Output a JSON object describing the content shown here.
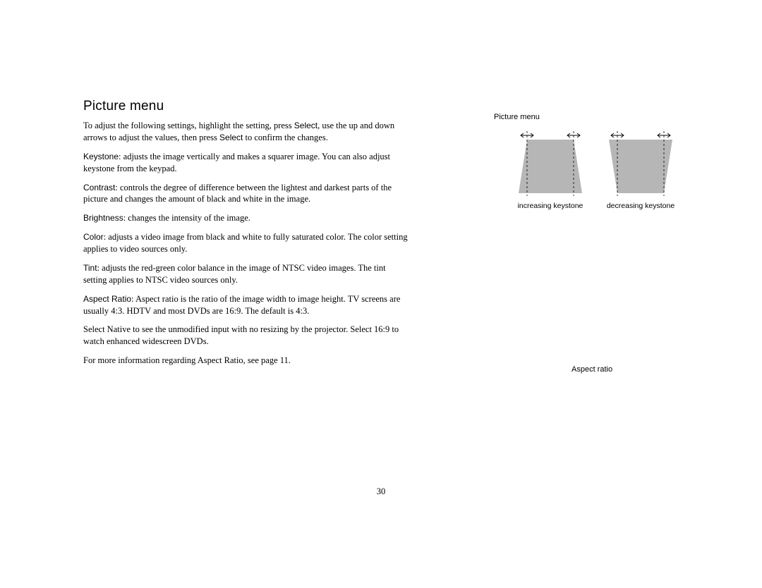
{
  "heading": "Picture menu",
  "intro": {
    "prefix": "To adjust the following settings, highlight the setting, press ",
    "select1": "Select",
    "middle1": ", use the up and down arrows to adjust the values, then press ",
    "select2": "Select",
    "suffix": " to confirm the changes."
  },
  "items": {
    "keystone": {
      "label": "Keystone",
      "text": ": adjusts the image vertically and makes a squarer image. You can also adjust keystone from the keypad."
    },
    "contrast": {
      "label": "Contrast",
      "text": ": controls the degree of difference between the lightest and darkest parts of the picture and changes the amount of black and white in the image."
    },
    "brightness": {
      "label": "Brightness",
      "text": ": changes the intensity of the image."
    },
    "color": {
      "label": "Color",
      "text": ": adjusts a video image from black and white to fully saturated color. The color setting applies to video sources only."
    },
    "tint": {
      "label": "Tint",
      "text": ": adjusts the red-green color balance in the image of NTSC video images. The tint setting applies to NTSC video sources only."
    },
    "aspect": {
      "label": "Aspect Ratio",
      "text": ": Aspect ratio is the ratio of the image width to image height. TV screens are usually 4:3. HDTV and most DVDs are 16:9. The default is 4:3."
    }
  },
  "native_para": "Select Native to see the unmodified input with no resizing by the projector. Select 16:9 to watch enhanced widescreen DVDs.",
  "more_info": "For more information regarding Aspect Ratio, see page 11.",
  "fig": {
    "title": "Picture menu",
    "inc": "increasing keystone",
    "dec": "decreasing keystone",
    "aspect": "Aspect ratio"
  },
  "page_number": "30"
}
